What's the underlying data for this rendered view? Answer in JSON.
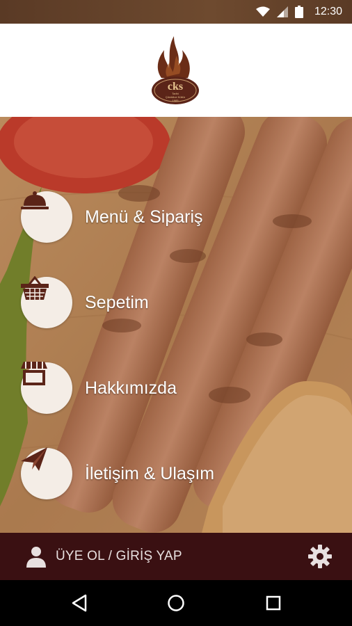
{
  "status_bar": {
    "time": "12:30",
    "icons": [
      "wifi-icon",
      "signal-icon",
      "battery-icon"
    ]
  },
  "header": {
    "logo": {
      "brand": "cks",
      "lines": [
        "Tarihi",
        "Çöreklice Kültür",
        "1985"
      ]
    }
  },
  "menu": {
    "items": [
      {
        "label": "Menü & Sipariş",
        "icon": "cloche-icon"
      },
      {
        "label": "Sepetim",
        "icon": "basket-icon"
      },
      {
        "label": "Hakkımızda",
        "icon": "store-icon"
      },
      {
        "label": "İletişim & Ulaşım",
        "icon": "paper-plane-icon"
      }
    ]
  },
  "bottom_bar": {
    "login_label": "ÜYE OL / GİRİŞ YAP",
    "login_icon": "user-icon",
    "settings_icon": "gear-icon"
  },
  "nav_bar": {
    "buttons": [
      "back-icon",
      "home-icon",
      "recents-icon"
    ]
  },
  "colors": {
    "bottom_bar": "#3a1012",
    "icon_brown": "#5b2418",
    "circle_bg": "#f4ede6",
    "header_bg": "#ffffff"
  }
}
